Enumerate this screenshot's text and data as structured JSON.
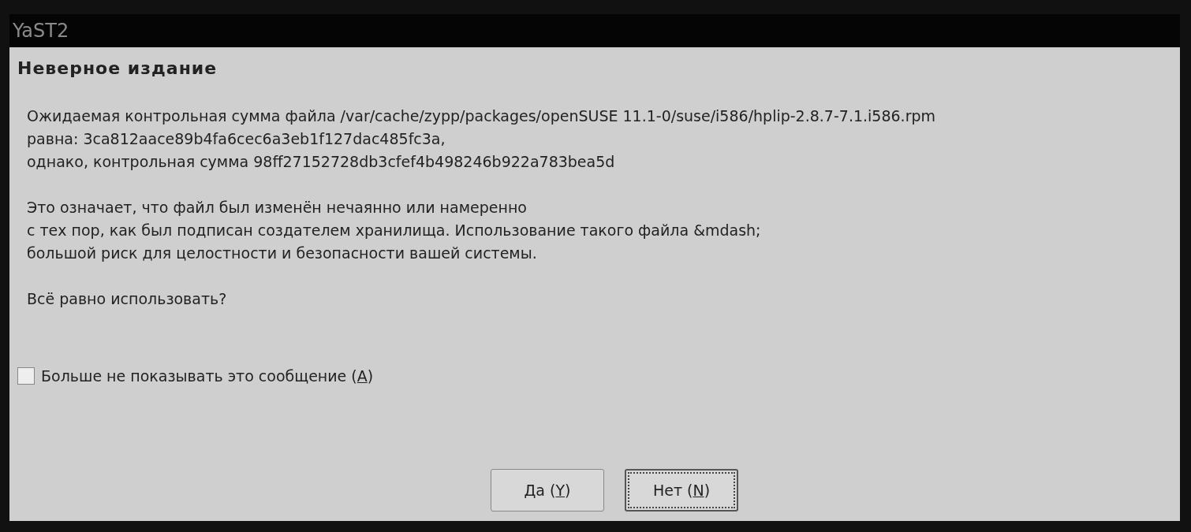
{
  "window": {
    "title": "YaST2"
  },
  "dialog": {
    "heading": "Неверное издание",
    "paragraphs": [
      {
        "lines": [
          "Ожидаемая контрольная сумма файла /var/cache/zypp/packages/openSUSE 11.1-0/suse/i586/hplip-2.8.7-7.1.i586.rpm",
          "равна: 3ca812aace89b4fa6cec6a3eb1f127dac485fc3a,",
          "однако, контрольная сумма 98ff27152728db3cfef4b498246b922a783bea5d"
        ]
      },
      {
        "lines": [
          "Это означает, что файл был изменён нечаянно или намеренно",
          "с тех пор, как был подписан создателем хранилища. Использование такого файла &mdash;",
          "большой риск для целостности и безопасности вашей системы."
        ]
      },
      {
        "lines": [
          "Всё равно использовать?"
        ]
      }
    ],
    "checkbox": {
      "text_before": "Больше не показывать это сообщение (",
      "mnemonic": "A",
      "text_after": ")",
      "checked": false
    },
    "buttons": [
      {
        "text_before": "Да (",
        "mnemonic": "Y",
        "text_after": ")",
        "focused": false
      },
      {
        "text_before": "Нет (",
        "mnemonic": "N",
        "text_after": ")",
        "focused": true
      }
    ]
  }
}
